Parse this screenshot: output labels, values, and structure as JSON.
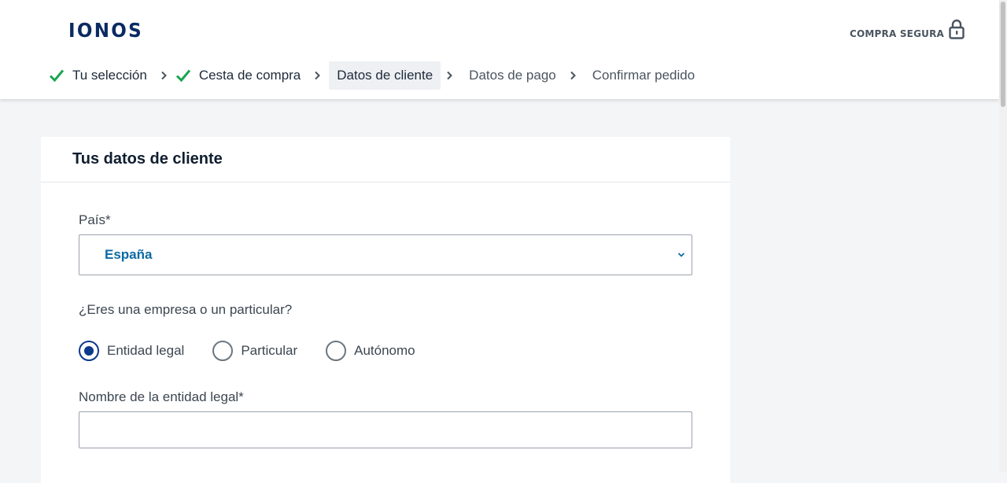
{
  "header": {
    "logo": "IONOS",
    "secure_label": "COMPRA SEGURA"
  },
  "steps": [
    {
      "label": "Tu selección",
      "state": "done"
    },
    {
      "label": "Cesta de compra",
      "state": "done"
    },
    {
      "label": "Datos de cliente",
      "state": "active"
    },
    {
      "label": "Datos de pago",
      "state": "pending"
    },
    {
      "label": "Confirmar pedido",
      "state": "pending"
    }
  ],
  "form": {
    "title": "Tus datos de cliente",
    "country_label": "País*",
    "country_value": "España",
    "customer_type_label": "¿Eres una empresa o un particular?",
    "customer_types": [
      {
        "label": "Entidad legal",
        "checked": true
      },
      {
        "label": "Particular",
        "checked": false
      },
      {
        "label": "Autónomo",
        "checked": false
      }
    ],
    "entity_name_label": "Nombre de la entidad legal*",
    "entity_name_value": ""
  },
  "colors": {
    "brand": "#0b2a63",
    "check": "#1aa650",
    "accent_value": "#0b6aa2",
    "radio_checked": "#0b3a8c"
  }
}
